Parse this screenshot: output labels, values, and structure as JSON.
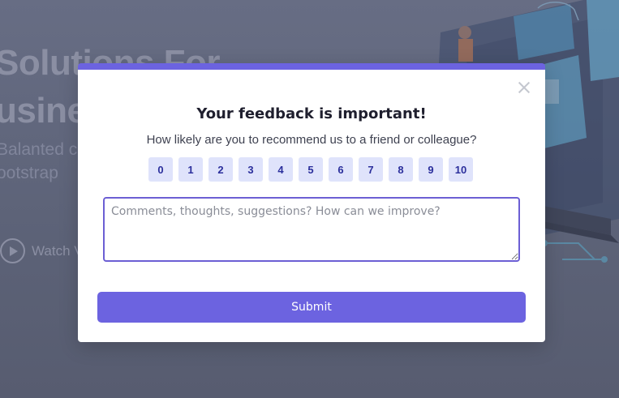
{
  "background": {
    "hero_line1": "Solutions For",
    "hero_line2": "usines",
    "sub_line1": "Balanted c",
    "sub_line2": "ootstrap",
    "watch_label": "Watch V"
  },
  "modal": {
    "accent_color": "#6c63e0",
    "title": "Your feedback is important!",
    "question": "How likely are you to recommend us to a friend or colleague?",
    "scale": [
      "0",
      "1",
      "2",
      "3",
      "4",
      "5",
      "6",
      "7",
      "8",
      "9",
      "10"
    ],
    "comment_placeholder": "Comments, thoughts, suggestions? How can we improve?",
    "comment_value": "",
    "submit_label": "Submit",
    "close_icon": "close-icon"
  }
}
